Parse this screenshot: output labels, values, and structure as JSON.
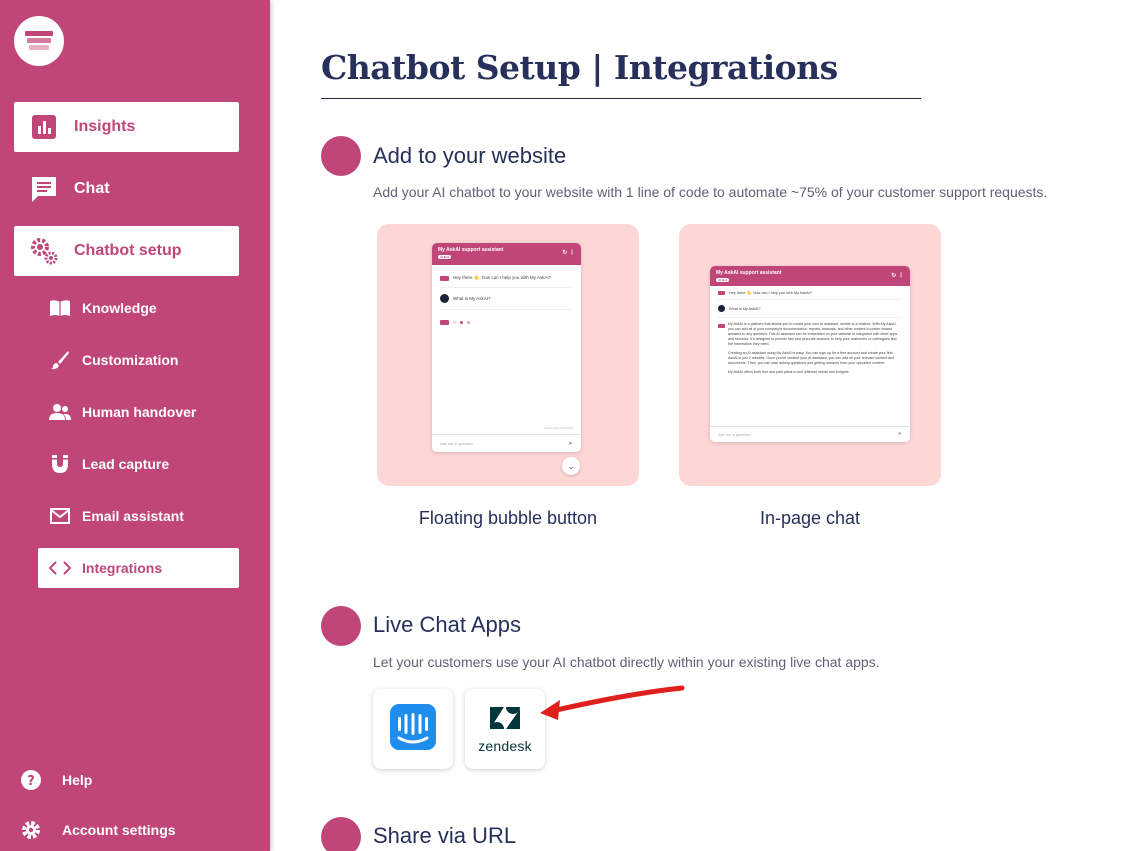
{
  "sidebar": {
    "nav_main": [
      {
        "label": "Insights",
        "icon": "bar-chart-icon"
      },
      {
        "label": "Chat",
        "icon": "chat-bubble-icon"
      },
      {
        "label": "Chatbot setup",
        "icon": "gears-icon"
      }
    ],
    "nav_sub": [
      {
        "label": "Knowledge",
        "icon": "book-icon"
      },
      {
        "label": "Customization",
        "icon": "brush-icon"
      },
      {
        "label": "Human handover",
        "icon": "people-icon"
      },
      {
        "label": "Lead capture",
        "icon": "magnet-icon"
      },
      {
        "label": "Email assistant",
        "icon": "mail-icon"
      },
      {
        "label": "Integrations",
        "icon": "code-brackets-icon"
      }
    ],
    "footer": [
      {
        "label": "Help",
        "icon": "help-circle-icon"
      },
      {
        "label": "Account settings",
        "icon": "gear-icon"
      }
    ]
  },
  "page": {
    "title": "Chatbot Setup | Integrations"
  },
  "sections": {
    "website": {
      "title": "Add to your website",
      "description": "Add your AI chatbot to your website with 1 line of code to automate ~75% of your customer support requests.",
      "options": [
        {
          "label": "Floating bubble button"
        },
        {
          "label": "In-page chat"
        }
      ]
    },
    "live_chat": {
      "title": "Live Chat Apps",
      "description": "Let your customers use your AI chatbot directly within your existing live chat apps.",
      "apps": [
        {
          "name": "Intercom",
          "icon": "intercom-logo-icon"
        },
        {
          "name": "zendesk",
          "icon": "zendesk-logo-icon"
        }
      ]
    },
    "share": {
      "title": "Share via URL"
    }
  },
  "preview": {
    "header_title": "My AskAI support assistant",
    "tag": "AI Bot",
    "greeting": "Hey there 👋, how can I help you with My AskAI?",
    "question_float": "What is My AskAI?",
    "question_inpage": "What is My AskAI?",
    "answer_p1": "My AskAI is a platform that allows you to create your own AI assistant, similar to a chatbot. With My AskAI, you can add all of your company's documentation, reports, manuals, and other content to power instant answers to any question. This AI assistant can be embedded on your website or integrated with other apps and services. It's designed to provide fast and accurate answers to help your customers or colleagues find the information they need.",
    "answer_p2": "Creating an AI assistant using My AskAI is easy. You can sign up for a free account and create your first AskAI in just 2 minutes. Once you've created your AI assistant, you can add all your relevant content and documents. Then, you can start asking questions and getting answers from your uploaded content.",
    "answer_p3": "My AskAI offers both free and paid plans to suit different needs and budgets.",
    "powered": "Powered by My AskAI",
    "input_placeholder": "Ask me a question"
  },
  "colors": {
    "brand": "#c0467a",
    "title": "#27305a",
    "preview_bg": "#fdd6d6",
    "intercom_blue": "#1f8ded",
    "zendesk_dark": "#03363d",
    "annotation_arrow": "#e0201c"
  }
}
